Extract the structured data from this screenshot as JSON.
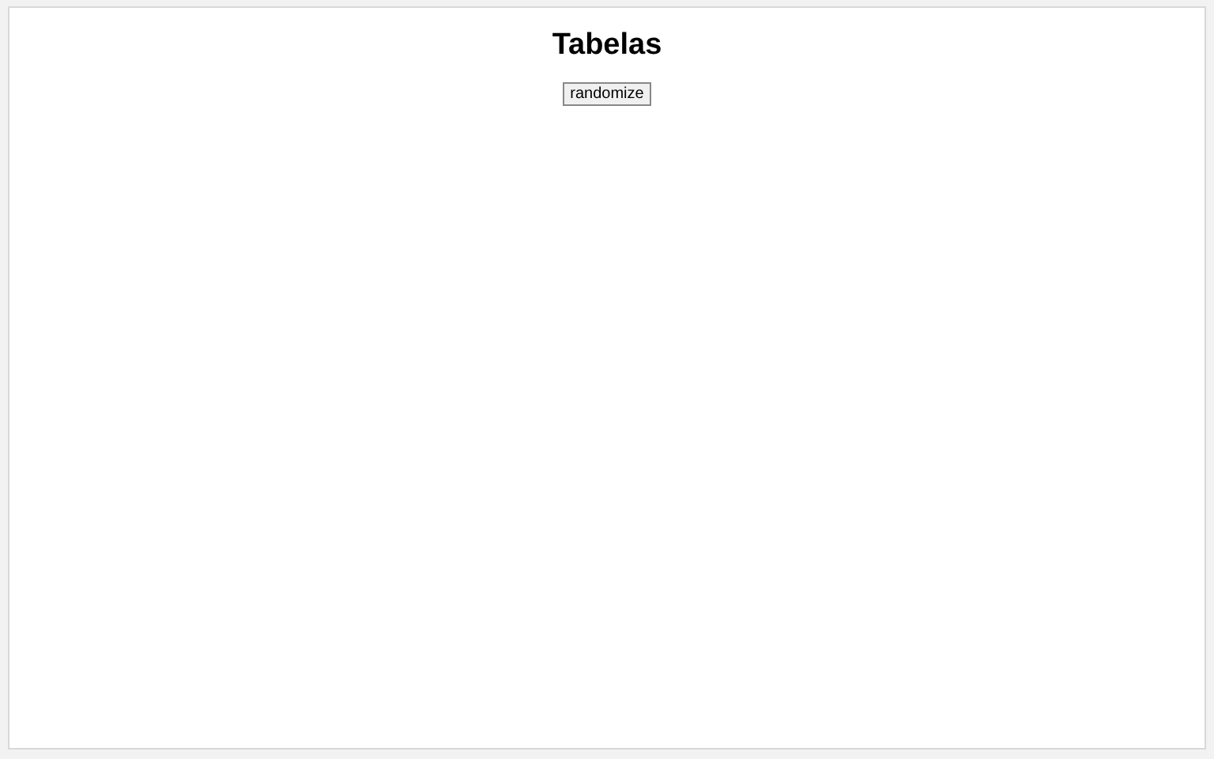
{
  "heading": "Tabelas",
  "button": {
    "label": "randomize"
  }
}
